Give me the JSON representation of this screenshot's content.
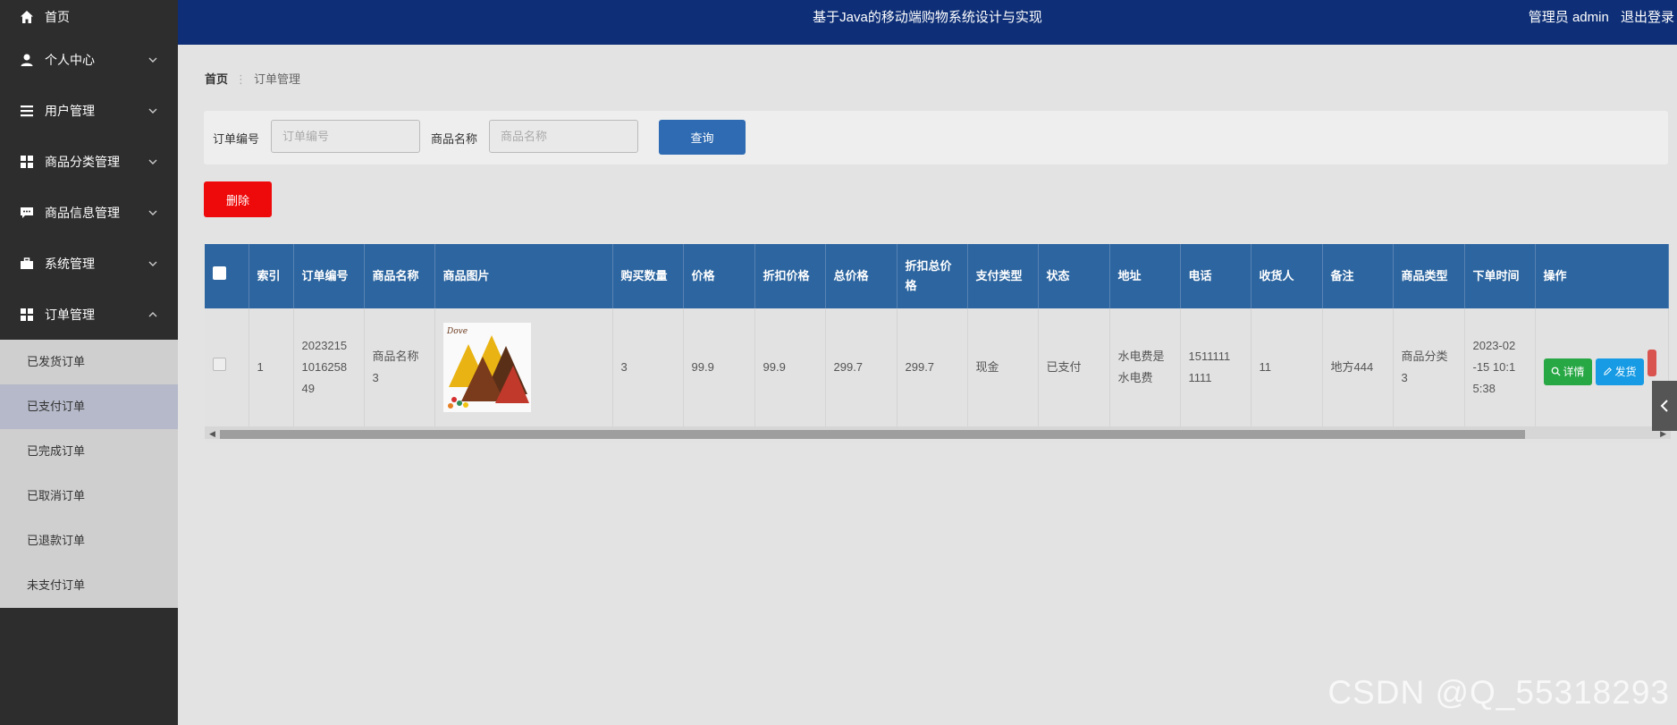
{
  "header": {
    "title": "基于Java的移动端购物系统设计与实现",
    "user_label": "管理员 admin",
    "logout": "退出登录",
    "bg_color": "#0e2f77"
  },
  "sidebar": {
    "items": [
      {
        "label": "首页",
        "icon": "home-icon"
      },
      {
        "label": "个人中心",
        "icon": "person-icon"
      },
      {
        "label": "用户管理",
        "icon": "list-icon"
      },
      {
        "label": "商品分类管理",
        "icon": "grid-icon"
      },
      {
        "label": "商品信息管理",
        "icon": "chat-icon"
      },
      {
        "label": "系统管理",
        "icon": "briefcase-icon"
      },
      {
        "label": "订单管理",
        "icon": "grid-icon"
      }
    ],
    "order_submenu": [
      "已发货订单",
      "已支付订单",
      "已完成订单",
      "已取消订单",
      "已退款订单",
      "未支付订单"
    ],
    "active_sub": "已支付订单"
  },
  "breadcrumb": {
    "home": "首页",
    "current": "订单管理"
  },
  "search": {
    "order_no_label": "订单编号",
    "order_no_placeholder": "订单编号",
    "product_label": "商品名称",
    "product_placeholder": "商品名称",
    "query_button": "查询"
  },
  "actions": {
    "delete_button": "删除",
    "delete_color": "#ee0a0a"
  },
  "table": {
    "headers": [
      "索引",
      "订单编号",
      "商品名称",
      "商品图片",
      "购买数量",
      "价格",
      "折扣价格",
      "总价格",
      "折扣总价格",
      "支付类型",
      "状态",
      "地址",
      "电话",
      "收货人",
      "备注",
      "商品类型",
      "下单时间",
      "操作"
    ],
    "header_color": "#2c65a0",
    "rows": [
      {
        "index": "1",
        "order_no": "2023215 1016258 49",
        "product_name": "商品名称 3",
        "image_label": "Dove",
        "quantity": "3",
        "price": "99.9",
        "discount_price": "99.9",
        "total": "299.7",
        "discount_total": "299.7",
        "pay_type": "现金",
        "status": "已支付",
        "address": "水电费是 水电费",
        "phone": "1511111 1111",
        "receiver": "11",
        "remark": "地方444",
        "category": "商品分类 3",
        "order_time": "2023-02 -15 10:1 5:38",
        "ops": {
          "detail": "详情",
          "ship": "发货"
        }
      }
    ]
  },
  "watermark": "CSDN @Q_55318293"
}
